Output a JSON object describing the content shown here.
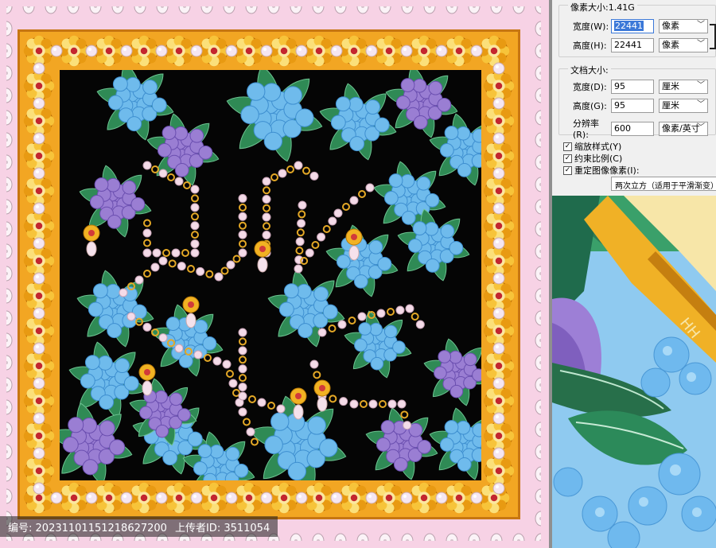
{
  "canvas": {
    "name": "scarf-design-artwork"
  },
  "watermark": {
    "id_label": "编号",
    "id_value": "20231101151218627200",
    "uploader_label": "上传者ID",
    "uploader_value": "3511054"
  },
  "dialog": {
    "pixel_size_title": "像素大小:1.41G",
    "width_label": "宽度(W):",
    "width_value": "22441",
    "height_label": "高度(H):",
    "height_value": "22441",
    "pixel_unit": "像素",
    "document_size_title": "文档大小:",
    "doc_width_label": "宽度(D):",
    "doc_width_value": "95",
    "doc_height_label": "高度(G):",
    "doc_height_value": "95",
    "resolution_label": "分辨率(R):",
    "resolution_value": "600",
    "cm_unit": "厘米",
    "resolution_unit": "像素/英寸",
    "scale_styles": "缩放样式(Y)",
    "constrain": "约束比例(C)",
    "resample": "重定图像像素(I):",
    "resample_method": "两次立方（适用于平滑渐变）"
  },
  "colors": {
    "background_pink": "#f7d2e5",
    "border_gold": "#f2a623",
    "inner_black": "#050505",
    "hydrangea_blue": "#69b7ea",
    "hydrangea_purple": "#9a7ed3",
    "leaf_green": "#2f8a55",
    "pearl": "#f7e7f0"
  }
}
